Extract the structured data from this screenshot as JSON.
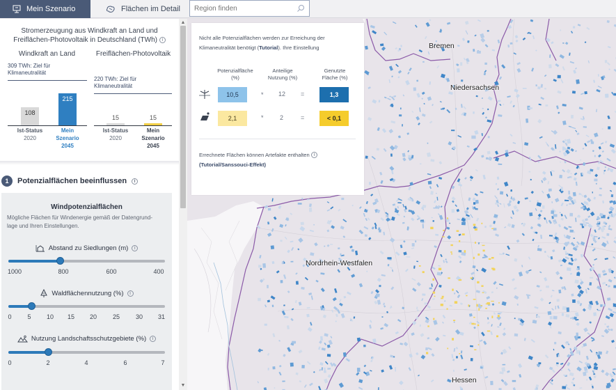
{
  "tabs": [
    {
      "label": "Mein Szenario",
      "active": true,
      "icon": "scenario-icon"
    },
    {
      "label": "Flächen im Detail",
      "active": false,
      "icon": "areas-icon"
    }
  ],
  "search": {
    "placeholder": "Region finden",
    "icon": "search-icon"
  },
  "summary_chart": {
    "title_line1": "Stromerzeugung aus Windkraft an Land und",
    "title_line2": "Freiflächen-Photovoltaik in Deutschland (TWh)",
    "wind_label": "Windkraft an Land",
    "pv_label": "Freiflächen-Photovoltaik",
    "wind_target_line1": "309 TWh: Ziel für",
    "wind_target_line2": "Klimaneutralität",
    "pv_target_line1": "220 TWh: Ziel für",
    "pv_target_line2": "Klimaneutralität",
    "ist_label": "Ist-Status",
    "ist_year": "2020",
    "szen_label_line1": "Mein",
    "szen_label_line2": "Szenario",
    "szen_year": "2045",
    "wind_ist_value": "108",
    "wind_szen_value": "215",
    "pv_ist_value": "15",
    "pv_szen_value": "15",
    "colors": {
      "ist": "#d9d9d9",
      "wind": "#2f7fc1",
      "pv": "#f2cf46"
    }
  },
  "chart_data": [
    {
      "type": "bar",
      "title": "Windkraft an Land",
      "categories": [
        "Ist-Status 2020",
        "Mein Szenario 2045"
      ],
      "values": [
        108,
        215
      ],
      "target": 309,
      "target_label": "309 TWh: Ziel für Klimaneutralität"
    },
    {
      "type": "bar",
      "title": "Freiflächen-Photovoltaik",
      "categories": [
        "Ist-Status 2020",
        "Mein Szenario 2045"
      ],
      "values": [
        15,
        15
      ],
      "target": 220,
      "target_label": "220 TWh: Ziel für Klimaneutralität"
    }
  ],
  "section": {
    "number": "1",
    "title": "Potenzialflächen beeinflussen"
  },
  "panel": {
    "title": "Windpotenzialflächen",
    "desc_line1": "Mögliche Flächen für Windenergie gemäß der Datengrund-",
    "desc_line2": "lage und Ihren Einstellungen."
  },
  "sliders": [
    {
      "label": "Abstand zu Siedlungen (m)",
      "icon": "house-distance-icon",
      "ticks": [
        "1000",
        "800",
        "600",
        "400"
      ],
      "value": 800
    },
    {
      "label": "Waldflächennutzung (%)",
      "icon": "forest-icon",
      "ticks": [
        "0",
        "5",
        "10",
        "15",
        "20",
        "25",
        "30",
        "31"
      ],
      "value": 3
    },
    {
      "label": "Nutzung Landschaftsschutzgebiete (%)",
      "icon": "landscape-icon",
      "ticks": [
        "0",
        "2",
        "4",
        "6",
        "7"
      ],
      "value": 2
    }
  ],
  "overlay": {
    "intro_1": "Nicht alle Potenzialflächen werden zur Erreichung der",
    "intro_2_pre": "Klimaneutralität benötigt (",
    "intro_2_link": "Tutorial",
    "intro_2_post": "). Ihre Einstellung",
    "col1_line1": "Potenzialfläche",
    "col1_line2": "(%)",
    "col2_line1": "Anteilige",
    "col2_line2": "Nutzung (%)",
    "col3_line1": "Genutzte",
    "col3_line2": "Fläche (%)",
    "wind_potential": "10,5",
    "wind_usage": "12",
    "wind_result": "1,3",
    "pv_potential": "2,1",
    "pv_usage": "2",
    "pv_result": "< 0,1",
    "times": "*",
    "equals": "=",
    "foot_1": "Errechnete Flächen können Artefakte enthalten",
    "foot_2": "(Tutorial/Sanssouci-Effekt)"
  },
  "map_labels": {
    "bremen": "Bremen",
    "niedersachsen": "Niedersachsen",
    "nrw": "Nordrhein-Westfalen",
    "hessen": "Hessen"
  }
}
